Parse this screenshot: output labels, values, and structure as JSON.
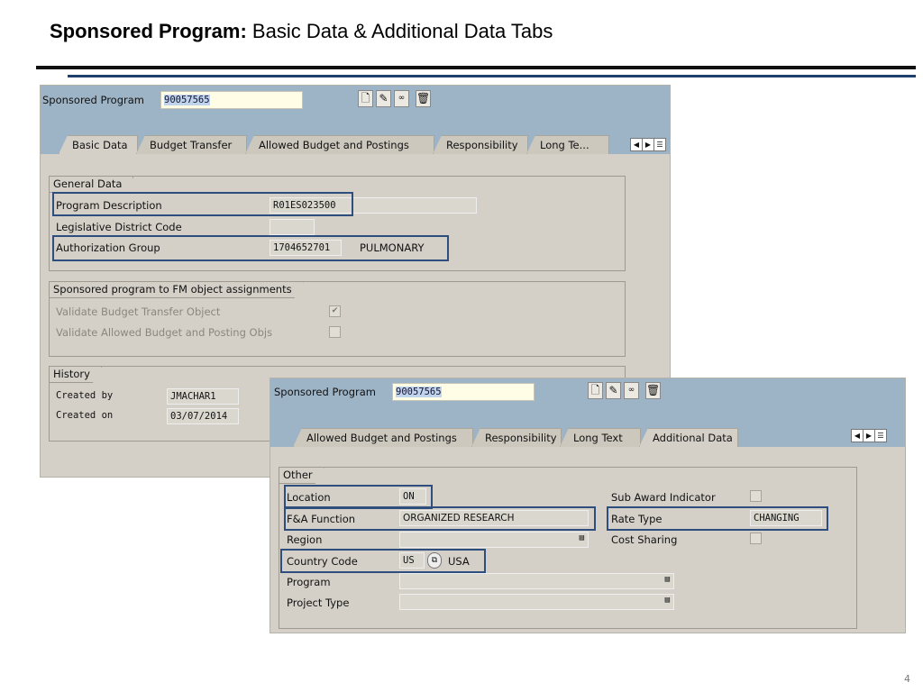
{
  "slide": {
    "title_bold": "Sponsored Program:",
    "title_rest": " Basic Data & Additional Data Tabs",
    "page_number": "4"
  },
  "highlight_color": "#2e4f7e",
  "window1": {
    "program_label": "Sponsored Program",
    "program_value": "90057565",
    "toolbar": [
      "new-icon",
      "edit-icon",
      "display-icon",
      "delete-icon"
    ],
    "tabs": [
      "Basic Data",
      "Budget Transfer",
      "Allowed Budget and Postings",
      "Responsibility",
      "Long Te..."
    ],
    "general": {
      "title": "General Data",
      "program_description_label": "Program Description",
      "program_description": "R01ES023500",
      "legislative_label": "Legislative District Code",
      "legislative_value": "",
      "auth_group_label": "Authorization Group",
      "auth_group": "1704652701",
      "auth_group_text": "PULMONARY"
    },
    "fm": {
      "title": "Sponsored program to FM object assignments",
      "validate_bt_label": "Validate Budget Transfer Object",
      "validate_bt_checked": true,
      "validate_ab_label": "Validate Allowed Budget and Posting Objs",
      "validate_ab_checked": false
    },
    "history": {
      "title": "History",
      "created_by_label": "Created by",
      "created_by": "JMACHAR1",
      "created_on_label": "Created on",
      "created_on": "03/07/2014"
    }
  },
  "window2": {
    "program_label": "Sponsored Program",
    "program_value": "90057565",
    "tabs": [
      "Allowed Budget and Postings",
      "Responsibility",
      "Long Text",
      "Additional Data"
    ],
    "other": {
      "title": "Other",
      "location_label": "Location",
      "location": "ON",
      "fa_label": "F&A Function",
      "fa": "ORGANIZED RESEARCH",
      "region_label": "Region",
      "region": "",
      "country_label": "Country Code",
      "country": "US",
      "country_text": "USA",
      "program_label": "Program",
      "program": "",
      "project_type_label": "Project Type",
      "project_type": "",
      "sub_award_label": "Sub Award Indicator",
      "sub_award_checked": false,
      "rate_type_label": "Rate Type",
      "rate_type": "CHANGING",
      "cost_sharing_label": "Cost Sharing",
      "cost_sharing_checked": false
    }
  }
}
